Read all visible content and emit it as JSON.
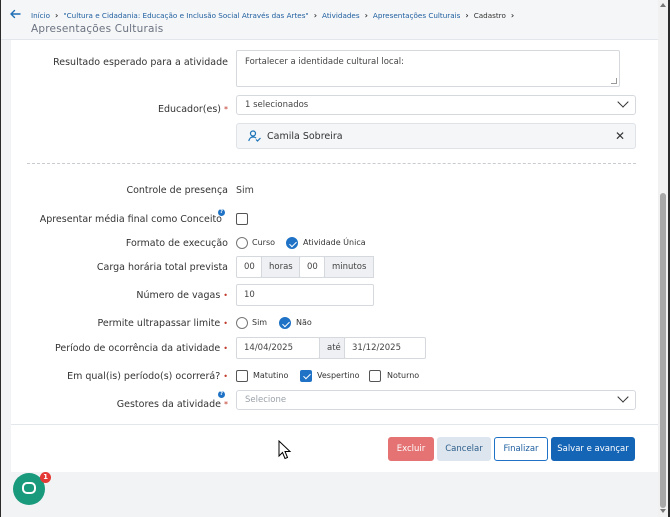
{
  "breadcrumb": {
    "items": [
      "Início",
      "\"Cultura e Cidadania: Educação e Inclusão Social Através das Artes\"",
      "Atividades",
      "Apresentações Culturais"
    ],
    "current": "Cadastro"
  },
  "page_title": "Apresentações Culturais",
  "form": {
    "resultado": {
      "label": "Resultado esperado para a atividade",
      "value": "Fortalecer a identidade cultural local:"
    },
    "educador": {
      "label": "Educador(es)",
      "required_mark": "*",
      "selected_text": "1 selecionados",
      "chip_name": "Camila Sobreira",
      "chip_remove": "✕"
    },
    "controle": {
      "label": "Controle de presença",
      "value": "Sim"
    },
    "media": {
      "label": "Apresentar média final como Conceito",
      "help": "?",
      "checked": false
    },
    "formato": {
      "label": "Formato de execução",
      "options": [
        "Curso",
        "Atividade Única"
      ],
      "selected": "Atividade Única"
    },
    "carga": {
      "label": "Carga horária total prevista",
      "hours_value": "00",
      "hours_unit": "horas",
      "minutes_value": "00",
      "minutes_unit": "minutos"
    },
    "vagas": {
      "label": "Número de vagas",
      "required_mark": "•",
      "value": "10"
    },
    "ultrapassar": {
      "label": "Permite ultrapassar limite",
      "required_mark": "•",
      "options": [
        "Sim",
        "Não"
      ],
      "selected": "Não"
    },
    "periodo": {
      "label": "Período de ocorrência da atividade",
      "required_mark": "•",
      "start": "14/04/2025",
      "separator": "até",
      "end": "31/12/2025"
    },
    "turnos": {
      "label": "Em qual(is) período(s) ocorrerá?",
      "required_mark": "•",
      "options": [
        "Matutino",
        "Vespertino",
        "Noturno"
      ],
      "checked": [
        "Vespertino"
      ]
    },
    "gestores": {
      "label": "Gestores da atividade",
      "required_mark": "*",
      "help": "?",
      "placeholder": "Selecione"
    }
  },
  "buttons": {
    "excluir": "Excluir",
    "cancelar": "Cancelar",
    "finalizar": "Finalizar",
    "salvar": "Salvar e avançar"
  },
  "chat": {
    "badge": "1"
  },
  "colors": {
    "primary": "#1565b7",
    "danger": "#e57373",
    "required": "#c0392b",
    "chat": "#1a9a7c"
  }
}
